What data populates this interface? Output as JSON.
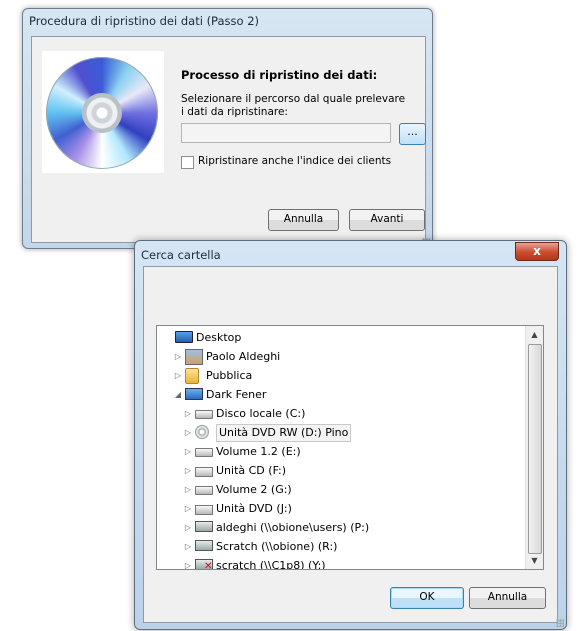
{
  "restore_dialog": {
    "title": "Procedura di ripristino dei dati (Passo 2)",
    "heading": "Processo di ripristino dei dati:",
    "description": "Selezionare il percorso dal quale prelevare i dati da ripristinare:",
    "path_value": "",
    "browse_label": "...",
    "checkbox_label": "Ripristinare anche l'indice dei clients",
    "checkbox_checked": false,
    "cancel_label": "Annulla",
    "next_label": "Avanti"
  },
  "browse_dialog": {
    "title": "Cerca cartella",
    "close_label": "x",
    "tree": [
      {
        "label": "Desktop",
        "icon": "desktop-icon",
        "arrow": ""
      },
      {
        "label": "Paolo Aldeghi",
        "icon": "user-folder-icon",
        "arrow": "▷"
      },
      {
        "label": "Pubblica",
        "icon": "folder-icon",
        "arrow": "▷"
      },
      {
        "label": "Dark Fener",
        "icon": "computer-icon",
        "arrow": "◢"
      },
      {
        "label": "Disco locale (C:)",
        "icon": "local-disk-icon",
        "arrow": "▷"
      },
      {
        "label": "Unità DVD RW (D:) Pino",
        "icon": "dvd-icon",
        "arrow": "▷",
        "selected": true
      },
      {
        "label": "Volume 1.2 (E:)",
        "icon": "drive-icon",
        "arrow": "▷"
      },
      {
        "label": "Unità CD (F:)",
        "icon": "cd-drive-icon",
        "arrow": "▷"
      },
      {
        "label": "Volume 2 (G:)",
        "icon": "drive-icon",
        "arrow": "▷"
      },
      {
        "label": "Unità DVD (J:)",
        "icon": "dvd-drive-icon",
        "arrow": "▷"
      },
      {
        "label": "aldeghi (\\\\obione\\users) (P:)",
        "icon": "network-drive-icon",
        "arrow": "▷"
      },
      {
        "label": "Scratch (\\\\obione) (R:)",
        "icon": "network-drive-icon",
        "arrow": "▷"
      },
      {
        "label": "scratch (\\\\C1p8) (Y:)",
        "icon": "disconnected-network-drive-icon",
        "arrow": "▷"
      }
    ],
    "ok_label": "OK",
    "cancel_label": "Annulla"
  }
}
